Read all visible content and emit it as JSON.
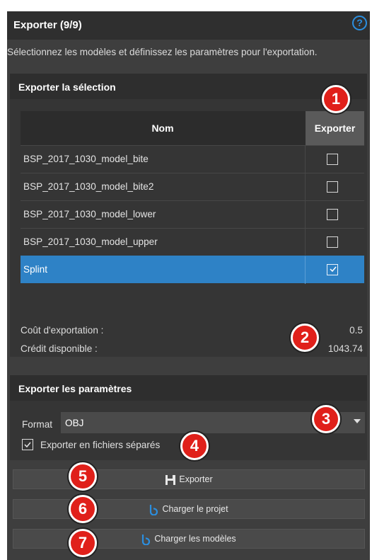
{
  "header": {
    "title": "Exporter (9/9)",
    "help": "?"
  },
  "description": "Sélectionnez les modèles et définissez les paramètres pour l'exportation.",
  "selection": {
    "title": "Exporter la sélection",
    "columns": {
      "name": "Nom",
      "export": "Exporter"
    },
    "rows": [
      {
        "name": "BSP_2017_1030_model_bite",
        "checked": false
      },
      {
        "name": "BSP_2017_1030_model_bite2",
        "checked": false
      },
      {
        "name": "BSP_2017_1030_model_lower",
        "checked": false
      },
      {
        "name": "BSP_2017_1030_model_upper",
        "checked": false
      },
      {
        "name": "Splint",
        "checked": true,
        "selected": true
      }
    ],
    "cost_label": "Coût d'exportation :",
    "cost_value": "0.5",
    "credit_label": "Crédit disponible :",
    "credit_value": "1043.74"
  },
  "params": {
    "title": "Exporter les paramètres",
    "format_label": "Format",
    "format_value": "OBJ",
    "separate_files_label": "Exporter en fichiers séparés",
    "separate_files_checked": true
  },
  "buttons": {
    "export": "Exporter",
    "load_project": "Charger le projet",
    "load_models": "Charger les modèles"
  },
  "badges": [
    "1",
    "2",
    "3",
    "4",
    "5",
    "6",
    "7"
  ],
  "colors": {
    "selection": "#2e82c6",
    "badge": "#e0201a",
    "accent": "#2b8fe0"
  },
  "icons": {
    "help": "help-icon",
    "save": "save-icon",
    "load": "blue-b-icon",
    "dropdown": "chevron-down-icon"
  }
}
